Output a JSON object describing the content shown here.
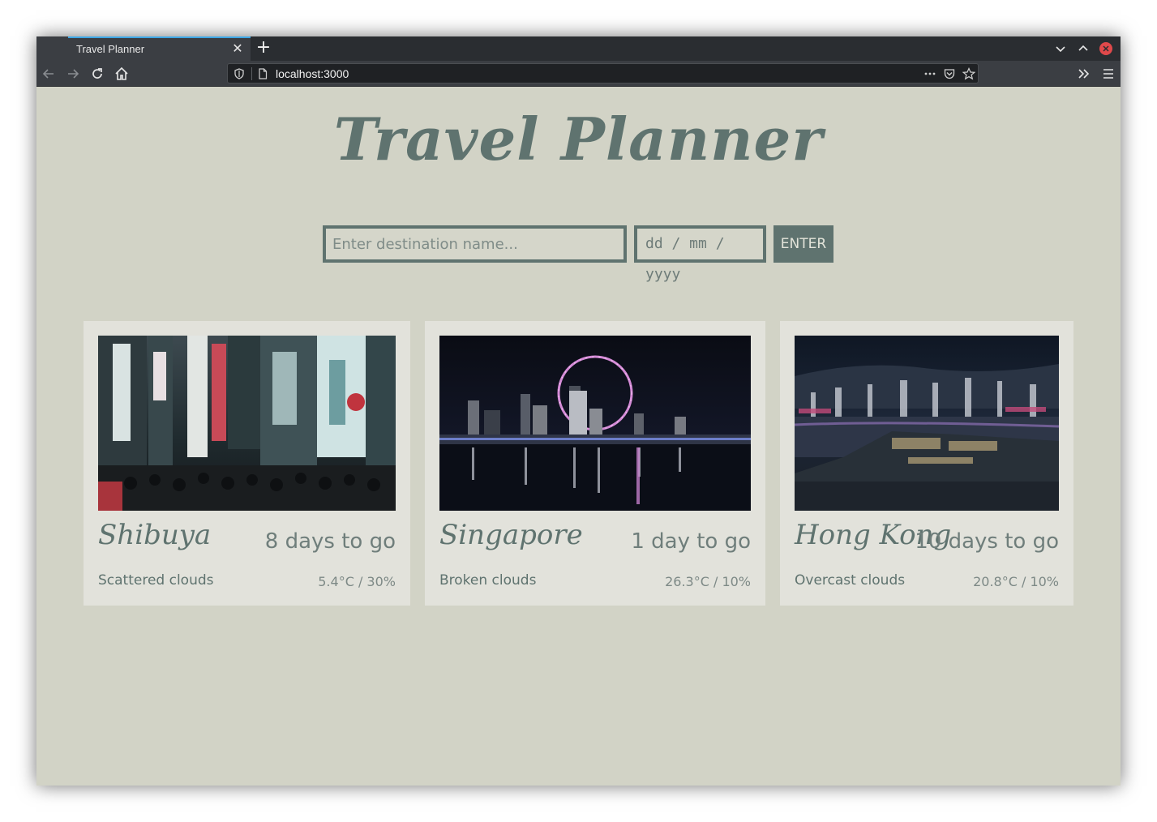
{
  "browser": {
    "tab_title": "Travel Planner",
    "url": "localhost:3000",
    "accent_color": "#3ea7e6"
  },
  "page": {
    "title": "Travel Planner",
    "destination_placeholder": "Enter destination name...",
    "date_placeholder": "dd / mm / yyyy",
    "enter_label": "ENTER",
    "theme_color": "#5f736f",
    "background_color": "#d2d3c6"
  },
  "trips": [
    {
      "place": "Shibuya",
      "countdown": "8 days to go",
      "weather": "Scattered clouds",
      "temp": "5.4°C / 30%"
    },
    {
      "place": "Singapore",
      "countdown": "1 day to go",
      "weather": "Broken clouds",
      "temp": "26.3°C / 10%"
    },
    {
      "place": "Hong Kong",
      "countdown": "10 days to go",
      "weather": "Overcast clouds",
      "temp": "20.8°C / 10%"
    }
  ]
}
